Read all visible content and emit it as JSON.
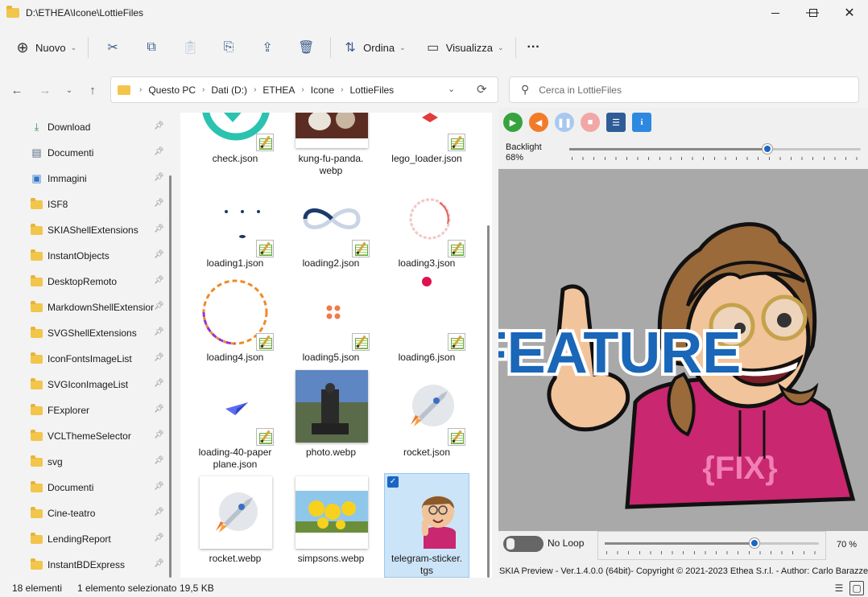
{
  "window": {
    "title": "D:\\ETHEA\\Icone\\LottieFiles",
    "minimize": "—",
    "maximize": "☐",
    "close": "✕"
  },
  "toolbar": {
    "new_label": "Nuovo",
    "sort_label": "Ordina",
    "view_label": "Visualizza",
    "more_label": "···"
  },
  "address": {
    "crumbs": [
      "Questo PC",
      "Dati (D:)",
      "ETHEA",
      "Icone",
      "LottieFiles"
    ]
  },
  "search": {
    "placeholder": "Cerca in LottieFiles"
  },
  "sidebar": {
    "items": [
      {
        "label": "Download",
        "icon": "download-icon"
      },
      {
        "label": "Documenti",
        "icon": "document-icon"
      },
      {
        "label": "Immagini",
        "icon": "pictures-icon"
      },
      {
        "label": "ISF8",
        "icon": "folder-icon"
      },
      {
        "label": "SKIAShellExtensions",
        "icon": "folder-icon"
      },
      {
        "label": "InstantObjects",
        "icon": "folder-icon"
      },
      {
        "label": "DesktopRemoto",
        "icon": "folder-icon"
      },
      {
        "label": "MarkdownShellExtensions",
        "icon": "folder-icon"
      },
      {
        "label": "SVGShellExtensions",
        "icon": "folder-icon"
      },
      {
        "label": "IconFontsImageList",
        "icon": "folder-icon"
      },
      {
        "label": "SVGIconImageList",
        "icon": "folder-icon"
      },
      {
        "label": "FExplorer",
        "icon": "folder-icon"
      },
      {
        "label": "VCLThemeSelector",
        "icon": "folder-icon"
      },
      {
        "label": "svg",
        "icon": "folder-icon"
      },
      {
        "label": "Documenti",
        "icon": "folder-icon"
      },
      {
        "label": "Cine-teatro",
        "icon": "folder-icon"
      },
      {
        "label": "LendingReport",
        "icon": "folder-icon"
      },
      {
        "label": "InstantBDExpress",
        "icon": "folder-icon"
      }
    ]
  },
  "files": {
    "items": [
      {
        "name": "check.json"
      },
      {
        "name": "kung-fu-panda.\nwebp"
      },
      {
        "name": "lego_loader.json"
      },
      {
        "name": "loading1.json"
      },
      {
        "name": "loading2.json"
      },
      {
        "name": "loading3.json"
      },
      {
        "name": "loading4.json"
      },
      {
        "name": "loading5.json"
      },
      {
        "name": "loading6.json"
      },
      {
        "name": "loading-40-paper\nplane.json"
      },
      {
        "name": "photo.webp"
      },
      {
        "name": "rocket.json"
      },
      {
        "name": "rocket.webp"
      },
      {
        "name": "simpsons.webp"
      },
      {
        "name": "telegram-sticker.\ntgs"
      }
    ]
  },
  "preview": {
    "backlight_label": "Backlight",
    "backlight_value": "68%",
    "backlight_level": 0.68,
    "sticker_text": "FEATURE",
    "hoodie_text": "{FIX}",
    "loop_label": "No Loop",
    "frame_position": 0.7,
    "zoom_label": "70 %",
    "copyright": "SKIA Preview - Ver.1.4.0.0 (64bit)- Copyright © 2021-2023 Ethea S.r.l. - Author: Carlo Barazzetta"
  },
  "status": {
    "count": "18 elementi",
    "selection": "1 elemento selezionato",
    "size": "19,5 KB"
  }
}
